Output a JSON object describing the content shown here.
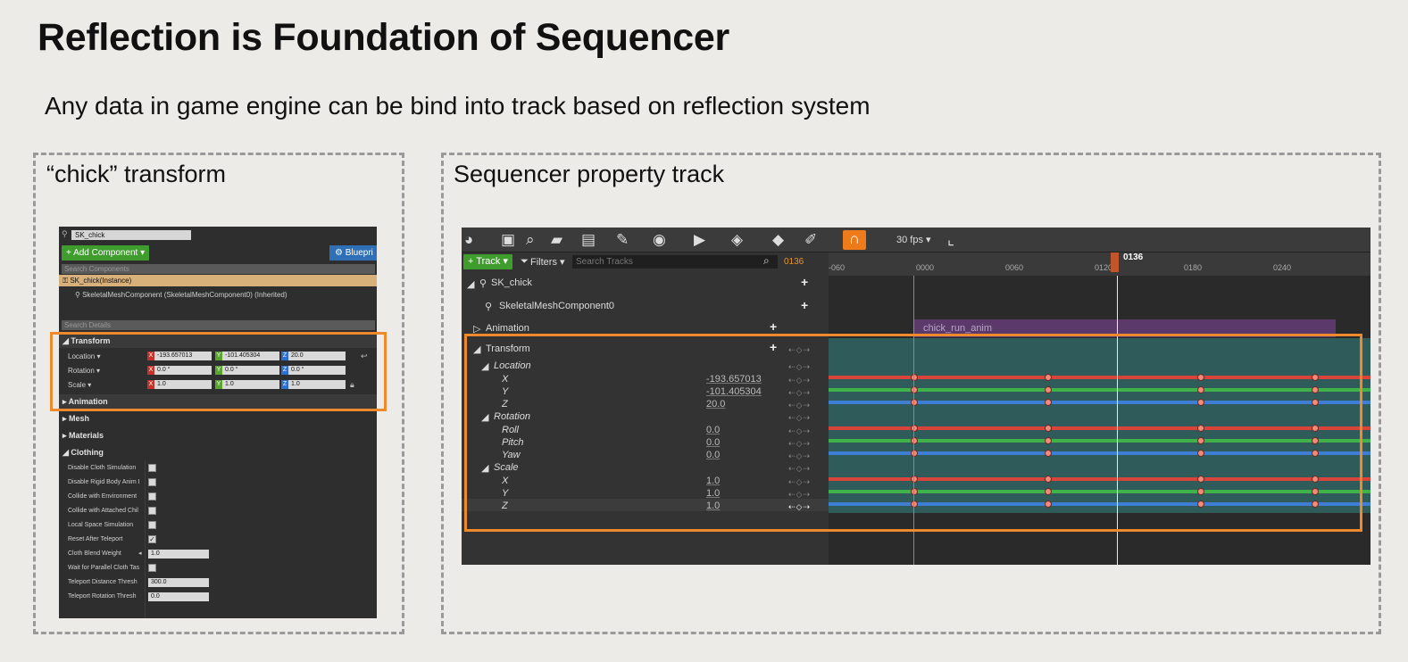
{
  "slide": {
    "title": "Reflection is Foundation of Sequencer",
    "subtitle": "Any data in game engine can be bind into track based on reflection system"
  },
  "left_panel": {
    "title": "“chick” transform",
    "details": {
      "actor_name": "SK_chick",
      "add_component": "+ Add Component ▾",
      "blueprint": "⚙ Bluepri",
      "search_components": "Search Components",
      "instance_item": "SK_chick(Instance)",
      "component_item": "SkeletalMeshComponent (SkeletalMeshComponent0) (Inherited)",
      "search_details": "Search Details",
      "transform_cat": "◢ Transform",
      "location_label": "Location ▾",
      "rotation_label": "Rotation ▾",
      "scale_label": "Scale ▾",
      "location": {
        "x": "-193.657013",
        "y": "-101.405304",
        "z": "20.0"
      },
      "rotation": {
        "x": "0.0 °",
        "y": "0.0 °",
        "z": "0.0 °"
      },
      "scale": {
        "x": "1.0",
        "y": "1.0",
        "z": "1.0"
      },
      "animation_cat": "▸ Animation",
      "mesh_cat": "▸ Mesh",
      "materials_cat": "▸ Materials",
      "clothing_cat": "◢ Clothing",
      "clothing_props": [
        "Disable Cloth Simulation",
        "Disable Rigid Body Anim I",
        "Collide with Environment",
        "Collide with Attached Chil",
        "Local Space Simulation",
        "Reset After Teleport"
      ],
      "reset_after_teleport_checked": true,
      "cloth_blend_weight_label": "Cloth Blend Weight",
      "cloth_blend_weight": "1.0",
      "wait_parallel_label": "Wait for Parallel Cloth Tas",
      "teleport_distance_label": "Teleport Distance Thresh",
      "teleport_distance": "300.0",
      "teleport_rotation_label": "Teleport Rotation Thresh",
      "teleport_rotation": "0.0"
    }
  },
  "right_panel": {
    "title": "Sequencer property track",
    "toolbar": {
      "fps": "30 fps ▾",
      "track_button": "+ Track ▾",
      "filters_button": "Filters ▾",
      "search_placeholder": "Search Tracks",
      "current_frame": "0136"
    },
    "ruler": {
      "ticks": [
        "-060",
        "0000",
        "0060",
        "0120",
        "0180",
        "0240"
      ],
      "playhead": "0136"
    },
    "tree": {
      "actor": "SK_chick",
      "component": "SkeletalMeshComponent0",
      "animation": "Animation",
      "transform": "Transform",
      "location": "Location",
      "rotation": "Rotation",
      "scale": "Scale",
      "loc_x_label": "X",
      "loc_y_label": "Y",
      "loc_z_label": "Z",
      "rot_roll_label": "Roll",
      "rot_pitch_label": "Pitch",
      "rot_yaw_label": "Yaw",
      "scl_x_label": "X",
      "scl_y_label": "Y",
      "scl_z_label": "Z",
      "loc_x": "-193.657013",
      "loc_y": "-101.405304",
      "loc_z": "20.0",
      "rot_roll": "0.0",
      "rot_pitch": "0.0",
      "rot_yaw": "0.0",
      "scl_x": "1.0",
      "scl_y": "1.0",
      "scl_z": "1.0"
    },
    "anim_clip": "chick_run_anim",
    "colors": {
      "x": "#d9443a",
      "y": "#3fb24a",
      "z": "#3f7ed6",
      "accent": "#ef8a2c"
    }
  }
}
